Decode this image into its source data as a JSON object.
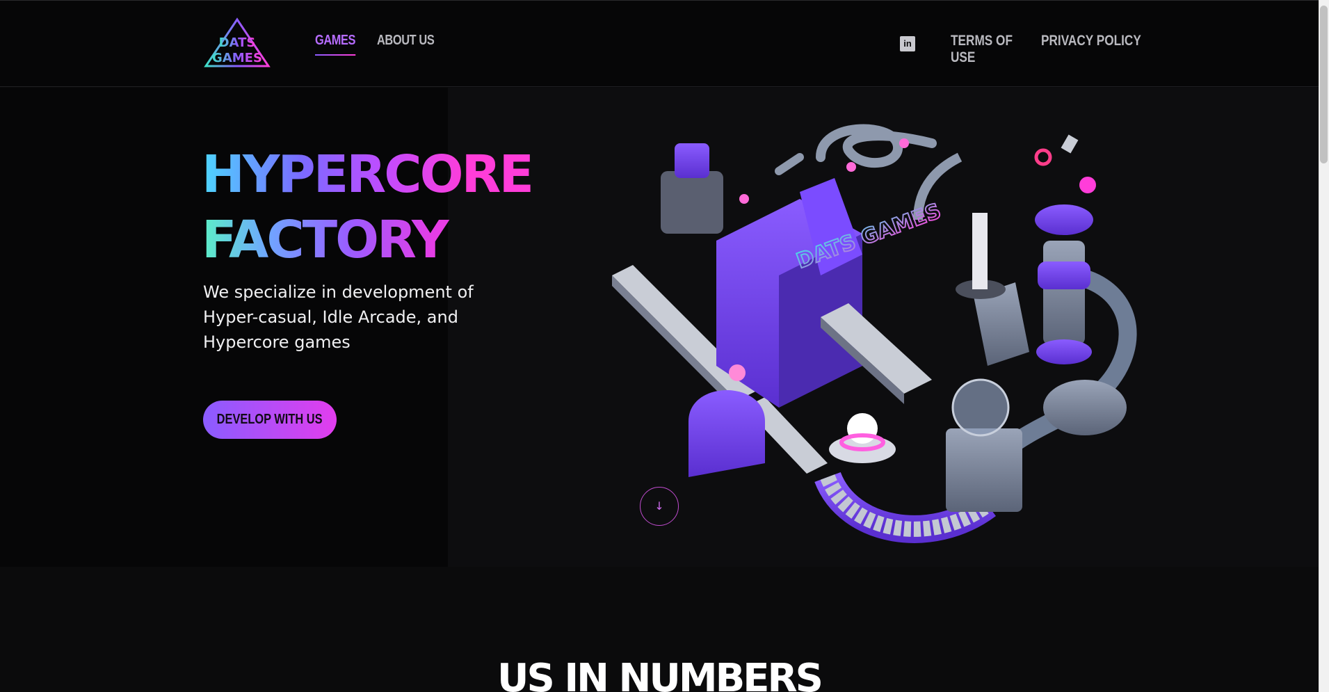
{
  "header": {
    "logo_text_top": "DATS",
    "logo_text_bottom": "GAMES",
    "nav": [
      {
        "label": "GAMES",
        "active": true
      },
      {
        "label": "ABOUT US",
        "active": false
      }
    ],
    "linkedin_icon": "linkedin-icon",
    "links": [
      {
        "label": "TERMS OF USE"
      },
      {
        "label": "PRIVACY POLICY"
      }
    ]
  },
  "hero": {
    "title_line1": "HYPERCORE",
    "title_line2": "FACTORY",
    "description": "We specialize in development of Hyper-casual, Idle Arcade, and Hypercore games",
    "cta_label": "DEVELOP WITH US",
    "scroll_icon": "arrow-down-icon",
    "scroll_glyph": "↓",
    "illustration_sign": "DATS GAMES"
  },
  "numbers": {
    "heading": "US IN NUMBERS"
  },
  "colors": {
    "accent_purple": "#8a5cff",
    "accent_pink": "#ff3dd9",
    "nav_active": "#b66cff",
    "background": "#0a0a0b"
  }
}
